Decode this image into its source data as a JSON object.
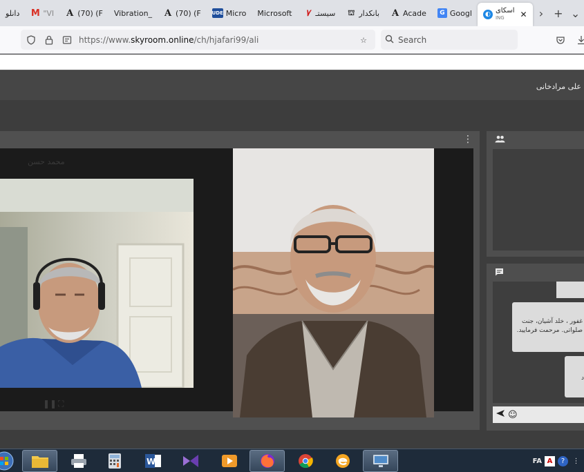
{
  "browser": {
    "tabs": [
      {
        "label": "دانلو",
        "icon": "none"
      },
      {
        "label": "\"VI",
        "icon": "gmail-icon"
      },
      {
        "label": "(70) (F",
        "icon": "academia-icon"
      },
      {
        "label": "Vibration_",
        "icon": "none"
      },
      {
        "label": "(70) (F",
        "icon": "academia-icon"
      },
      {
        "label": "Micro",
        "icon": "ude-icon"
      },
      {
        "label": "Microsoft",
        "icon": "none"
      },
      {
        "label": "سیستـ",
        "icon": "red-logo-icon"
      },
      {
        "label": "بانکدار",
        "icon": "bank-icon"
      },
      {
        "label": "Acade",
        "icon": "academia-icon"
      },
      {
        "label": "Googl",
        "icon": "google-translate-icon"
      }
    ],
    "active_tab": {
      "label": "اسکای",
      "sub": "ING"
    },
    "address": {
      "prefix": "https://www.",
      "domain": "skyroom.online",
      "path": "/ch/hjafari99/ali"
    },
    "search_placeholder": "Search"
  },
  "room": {
    "presenter_name": "علی مرادخانی"
  },
  "video": {
    "left_label": "محمد حسن"
  },
  "chat": {
    "message_2_line1": "غفور ، خلد آشیان، جنت",
    "message_2_line2": "صلواتی. مرحمت فرمایید.",
    "message_3": "د"
  },
  "taskbar": {
    "language": "FA"
  },
  "colors": {
    "skin": "#c79a7d",
    "shirt_blue": "#3a5fa5",
    "jacket_brown": "#4a3d33",
    "bg_dark": "#1b1b1b",
    "panel": "#505050"
  }
}
